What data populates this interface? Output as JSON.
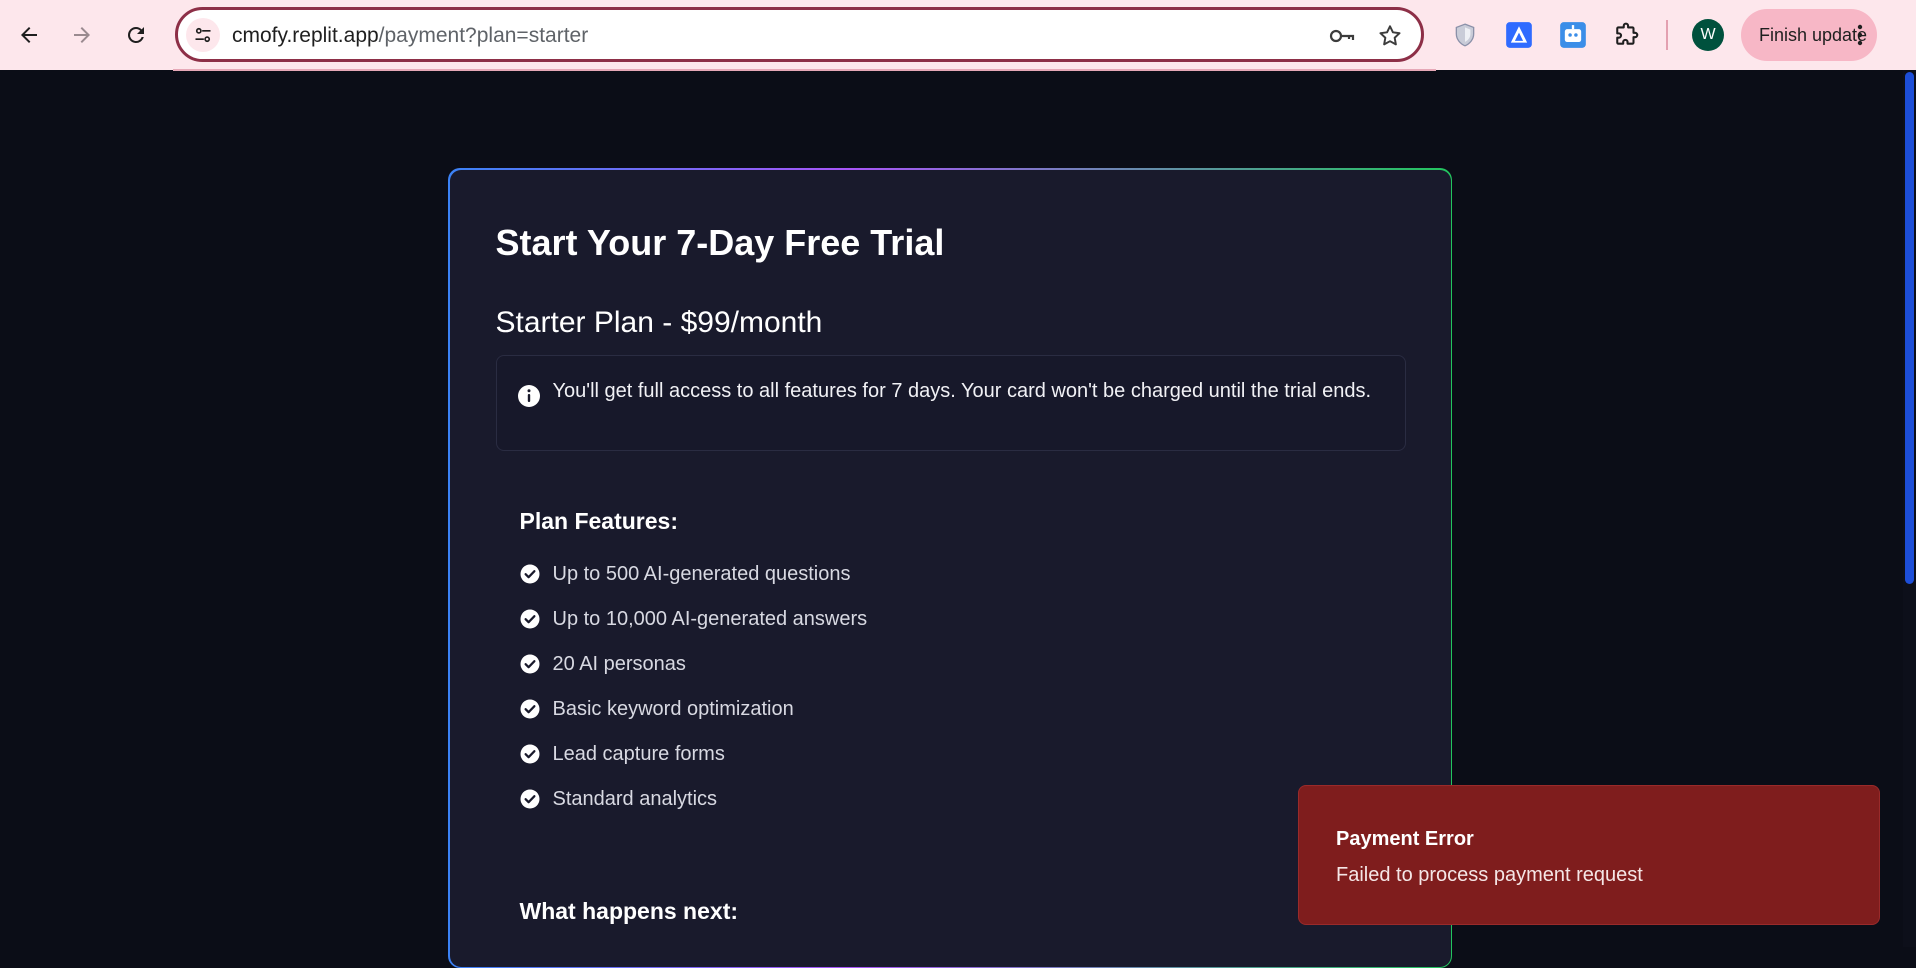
{
  "browser": {
    "url_host": "cmofy.replit.app",
    "url_path": "/payment?plan=starter",
    "finish_update_label": "Finish update",
    "profile_initial": "W",
    "icons": [
      "back-arrow-icon",
      "forward-arrow-icon",
      "reload-icon",
      "site-settings-icon",
      "key-icon",
      "star-icon",
      "shield-extension-icon",
      "triangle-extension-icon",
      "bot-extension-icon",
      "puzzle-extensions-icon",
      "more-vert-icon"
    ]
  },
  "page": {
    "title": "Start Your 7-Day Free Trial",
    "plan_title": "Starter Plan - $99/month",
    "info_text": "You'll get full access to all features for 7 days. Your card won't be charged until the trial ends.",
    "features_heading": "Plan Features:",
    "features": [
      "Up to 500 AI-generated questions",
      "Up to 10,000 AI-generated answers",
      "20 AI personas",
      "Basic keyword optimization",
      "Lead capture forms",
      "Standard analytics"
    ],
    "next_heading": "What happens next:"
  },
  "toast": {
    "title": "Payment Error",
    "message": "Failed to process payment request"
  },
  "colors": {
    "page_bg": "#0b0d17",
    "card_bg": "#191a2c",
    "toast_bg": "#7f1d1d",
    "chrome_bg": "#fde7ec",
    "accent_blue": "#3b82f6",
    "accent_green": "#22c55e"
  }
}
